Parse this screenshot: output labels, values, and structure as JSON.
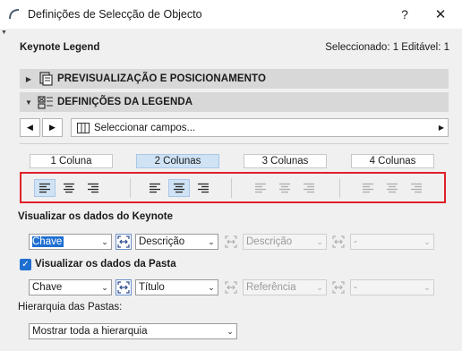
{
  "window": {
    "title": "Definições de Selecção de Objecto",
    "help_label": "?",
    "close_label": "✕"
  },
  "header": {
    "object_name": "Keynote Legend",
    "selection_info": "Seleccionado: 1 Editável: 1"
  },
  "sections": [
    {
      "label": "PREVISUALIZAÇÃO E POSICIONAMENTO",
      "expanded": false,
      "icon": "preview-position-icon"
    },
    {
      "label": "DEFINIÇÕES DA LEGENDA",
      "expanded": true,
      "icon": "legend-settings-icon"
    }
  ],
  "field_selector": {
    "prev_label": "◀",
    "next_label": "▶",
    "value": "Seleccionar campos...",
    "arrow": "▶"
  },
  "columns": {
    "options": [
      "1 Coluna",
      "2 Colunas",
      "3 Colunas",
      "4 Colunas"
    ],
    "active_index": 1
  },
  "alignment": {
    "groups": [
      {
        "enabled": true,
        "selected": "left"
      },
      {
        "enabled": true,
        "selected": "center"
      },
      {
        "enabled": false,
        "selected": "left"
      },
      {
        "enabled": false,
        "selected": "left"
      }
    ]
  },
  "keynote_data": {
    "label": "Visualizar os dados do Keynote",
    "fields": [
      {
        "value": "Chave",
        "enabled": true,
        "highlighted": true
      },
      {
        "value": "Descrição",
        "enabled": true
      },
      {
        "value": "Descrição",
        "enabled": false
      },
      {
        "value": "-",
        "enabled": false
      }
    ]
  },
  "folder_data": {
    "label": "Visualizar os dados da Pasta",
    "checked": true,
    "check_mark": "✓",
    "fields": [
      {
        "value": "Chave",
        "enabled": true
      },
      {
        "value": "Título",
        "enabled": true
      },
      {
        "value": "Referência",
        "enabled": false
      },
      {
        "value": "-",
        "enabled": false
      }
    ]
  },
  "hierarchy": {
    "label": "Hierarquia das Pastas:",
    "value": "Mostrar toda a hierarquia"
  },
  "colors": {
    "accent": "#1f6fd1",
    "active_bg": "#cfe3f5",
    "highlight_frame": "#e0202a",
    "section_bar": "#d8d8d8"
  }
}
